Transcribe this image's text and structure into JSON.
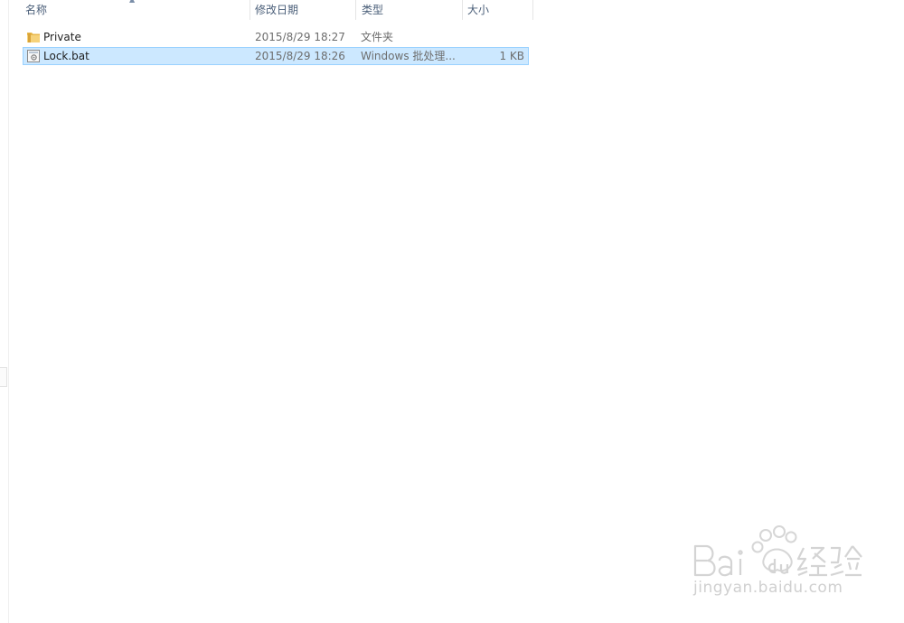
{
  "columns": {
    "name": "名称",
    "modified": "修改日期",
    "type": "类型",
    "size": "大小"
  },
  "files": [
    {
      "name": "Private",
      "modified": "2015/8/29 18:27",
      "type": "文件夹",
      "size": "",
      "icon": "folder-icon",
      "selected": false
    },
    {
      "name": "Lock.bat",
      "modified": "2015/8/29 18:26",
      "type": "Windows 批处理...",
      "size": "1 KB",
      "icon": "batch-file-icon",
      "selected": true
    }
  ],
  "watermark": {
    "brand": "Bai du 经验",
    "url": "jingyan.baidu.com"
  },
  "colors": {
    "selection_bg": "#cce8ff",
    "selection_border": "#99d1ff",
    "header_text": "#4c607a",
    "folder_yellow": "#e8b74a"
  }
}
